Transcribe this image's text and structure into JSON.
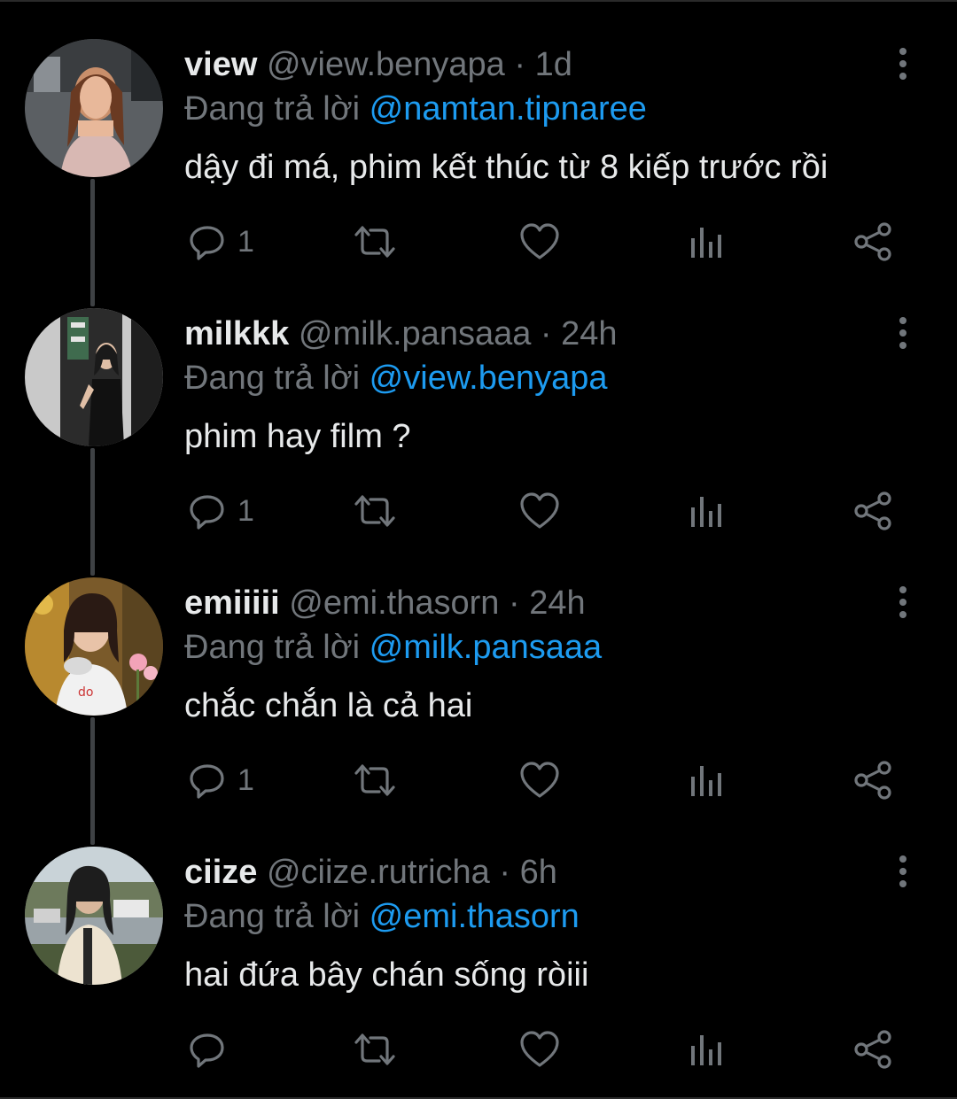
{
  "tweets": [
    {
      "name": "view",
      "handle": "@view.benyapa",
      "separator": "·",
      "time": "1d",
      "reply_prefix": "Đang trả lời",
      "reply_to": "@namtan.tipnaree",
      "text": "dậy đi má, phim kết thúc từ 8 kiếp trước rồi",
      "reply_count": "1"
    },
    {
      "name": "milkkk",
      "handle": "@milk.pansaaa",
      "separator": "·",
      "time": "24h",
      "reply_prefix": "Đang trả lời",
      "reply_to": "@view.benyapa",
      "text": "phim hay film ?",
      "reply_count": "1"
    },
    {
      "name": "emiiiii",
      "handle": "@emi.thasorn",
      "separator": "·",
      "time": "24h",
      "reply_prefix": "Đang trả lời",
      "reply_to": "@milk.pansaaa",
      "text": "chắc chắn là cả hai",
      "reply_count": "1"
    },
    {
      "name": "ciize",
      "handle": "@ciize.rutricha",
      "separator": "·",
      "time": "6h",
      "reply_prefix": "Đang trả lời",
      "reply_to": "@emi.thasorn",
      "text": "hai đứa bây chán sống ròiii",
      "reply_count": ""
    }
  ],
  "icons": {
    "reply": "reply-icon",
    "retweet": "retweet-icon",
    "like": "heart-icon",
    "views": "views-icon",
    "share": "share-icon",
    "more": "more-vertical-icon"
  },
  "colors": {
    "background": "#000000",
    "text": "#e7e9ea",
    "muted": "#71767b",
    "mention": "#1d9bf0",
    "thread_line": "#3e4144"
  }
}
